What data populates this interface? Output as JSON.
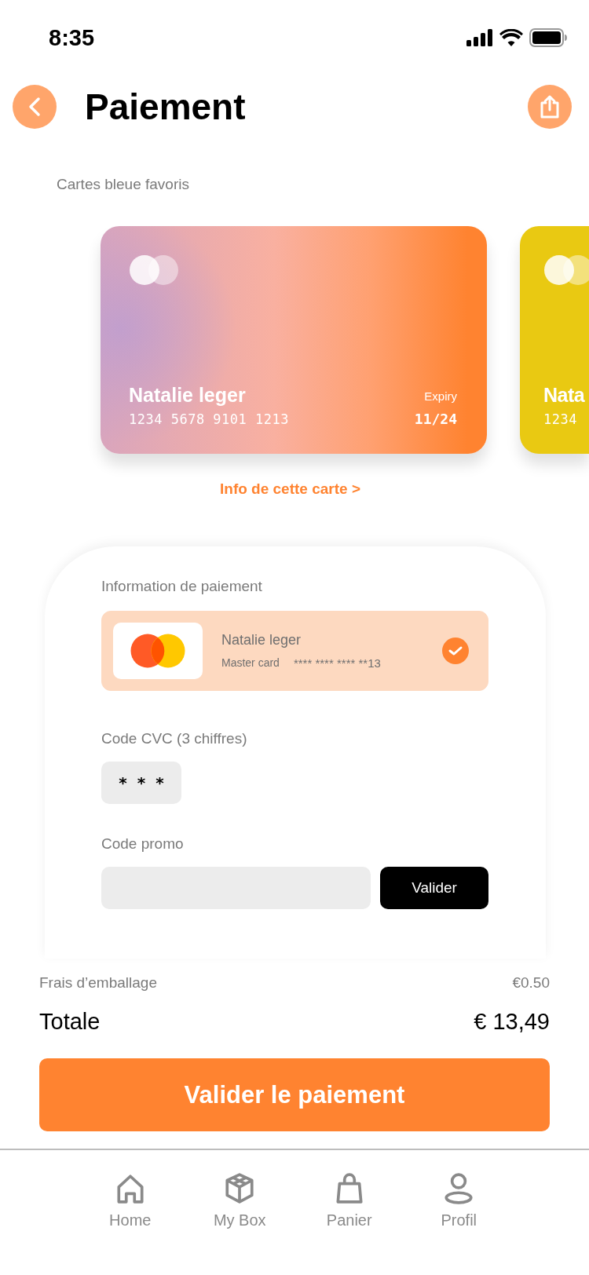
{
  "status_bar": {
    "time": "8:35"
  },
  "header": {
    "title": "Paiement"
  },
  "favorites": {
    "label": "Cartes bleue favoris",
    "cards": [
      {
        "name": "Natalie leger",
        "number": "1234 5678 9101 1213",
        "expiry_label": "Expiry",
        "expiry": "11/24",
        "color": "#ff8330"
      },
      {
        "name": "Nata",
        "number": "1234",
        "color": "#e9c912"
      }
    ],
    "info_link": "Info de cette carte >"
  },
  "payment": {
    "title": "Information de paiement",
    "methods": [
      {
        "holder": "Natalie leger",
        "brand": "Master card",
        "number": "**** **** **** **13",
        "selected": true
      }
    ],
    "cvc": {
      "label": "Code CVC (3 chiffres)",
      "value": "* * *"
    },
    "promo": {
      "label": "Code promo",
      "button": "Valider"
    }
  },
  "summary": {
    "fee_label": "Frais d’emballage",
    "fee": "€0.50",
    "total_label": "Totale",
    "total": "€ 13,49"
  },
  "submit": "Valider le paiement",
  "nav": [
    {
      "label": "Home"
    },
    {
      "label": "My Box"
    },
    {
      "label": "Panier"
    },
    {
      "label": "Profil"
    }
  ]
}
